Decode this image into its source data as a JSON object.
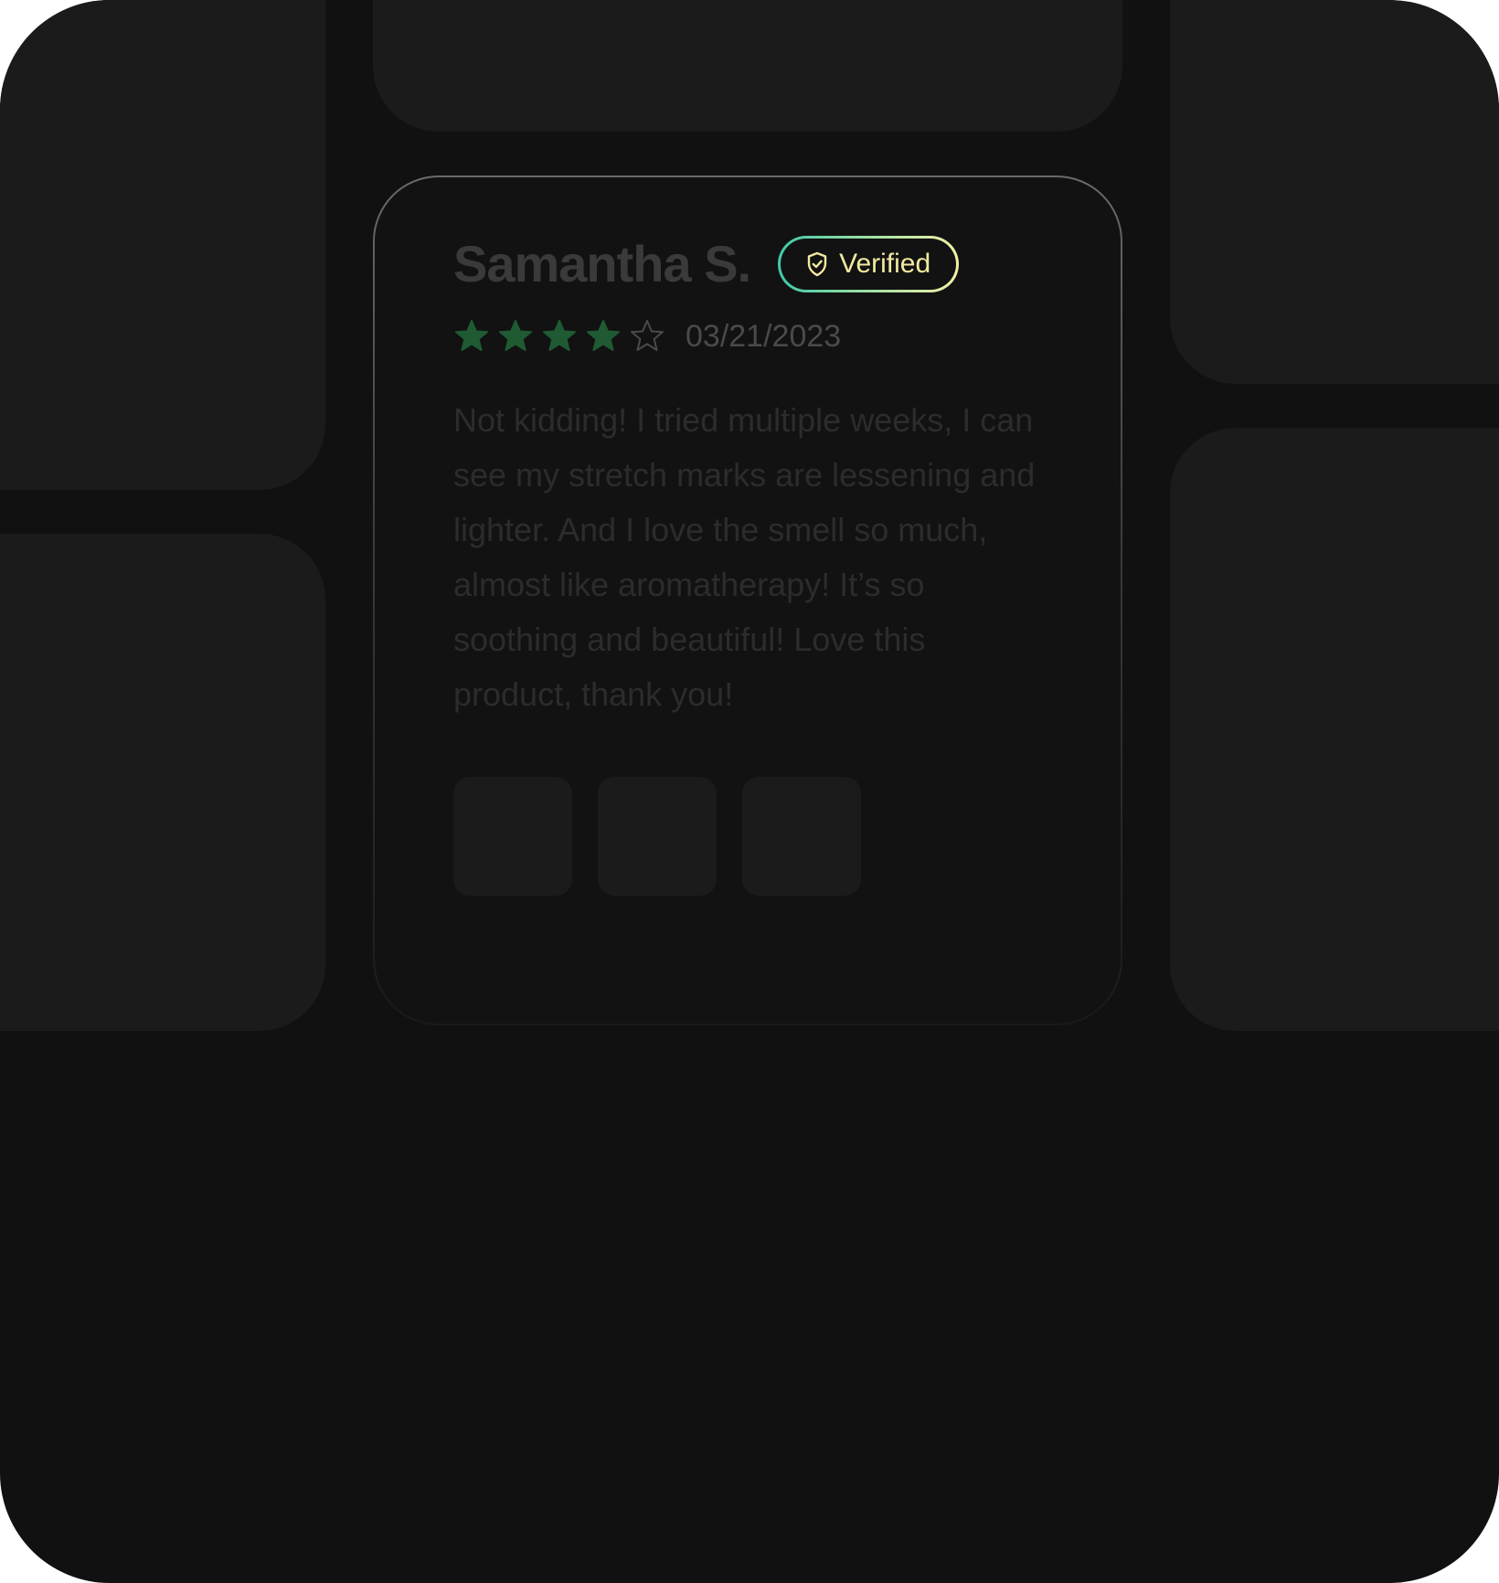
{
  "review": {
    "reviewer_name": "Samantha S.",
    "verified_label": "Verified",
    "rating": 4,
    "max_rating": 5,
    "date": "03/21/2023",
    "body": "Not kidding! I tried multiple weeks, I can see my stretch marks are lessening and lighter. And I love the smell so much, almost like aromatherapy! It’s so soothing and beautiful! Love this product, thank you!",
    "photo_count": 3
  },
  "colors": {
    "background": "#111111",
    "placeholder_card": "#1b1b1b",
    "star_filled": "#1f5a33",
    "star_empty_outline": "#4a4a4a",
    "badge_text": "#f1e9a0",
    "badge_gradient_start": "#3ec9a8",
    "badge_gradient_end": "#f3f0a6"
  },
  "icons": {
    "badge": "shield-check-icon",
    "star_filled": "star-filled-icon",
    "star_empty": "star-outline-icon"
  }
}
